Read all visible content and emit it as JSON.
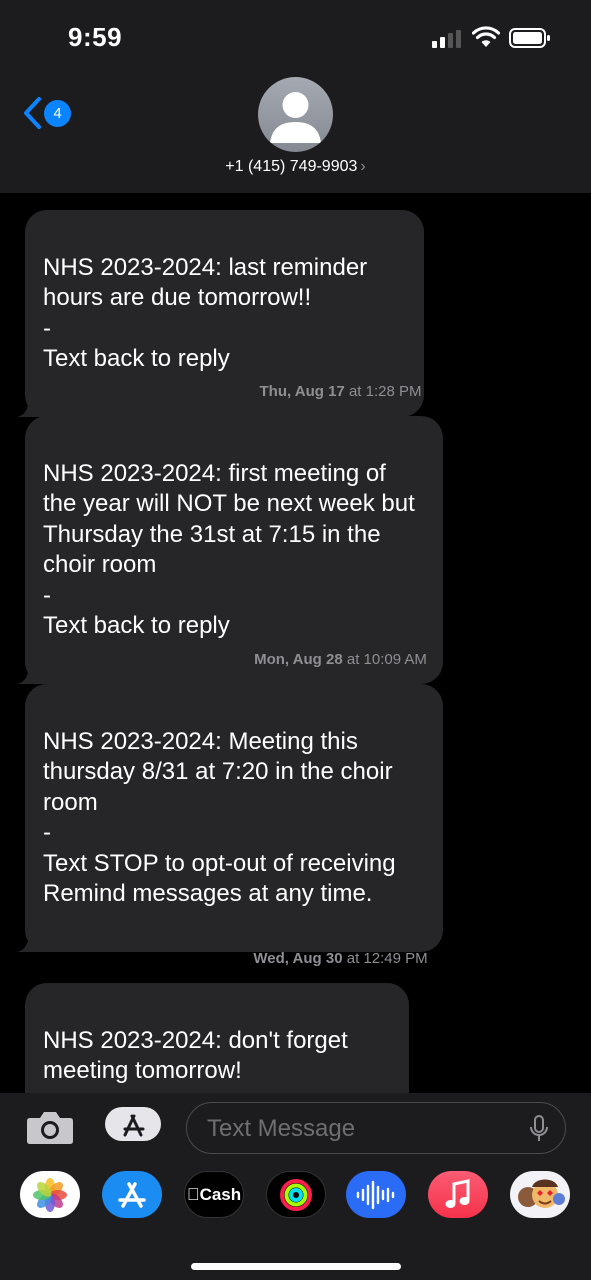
{
  "status_bar": {
    "time": "9:59"
  },
  "nav": {
    "back_count": "4",
    "contact": "+1 (415) 749-9903",
    "chevron": "›"
  },
  "messages": [
    {
      "text": "NHS 2023-2024: last reminder hours are due tomorrow!!\n-\nText back to reply"
    },
    {
      "text": "NHS 2023-2024: first meeting of the year will NOT be next week but Thursday the 31st at 7:15 in the choir room\n-\nText back to reply"
    },
    {
      "text": "NHS 2023-2024: Meeting this thursday 8/31 at 7:20 in the choir room\n-\nText STOP to opt-out of receiving Remind messages at any time."
    },
    {
      "text": "NHS 2023-2024: don't forget meeting tomorrow!\n-"
    }
  ],
  "timestamps": [
    {
      "day": "Thu, Aug 17",
      "time": " at 1:28 PM"
    },
    {
      "day": "Mon, Aug 28",
      "time": " at 10:09 AM"
    },
    {
      "day": "Wed, Aug 30",
      "time": " at 12:49 PM"
    }
  ],
  "composer": {
    "placeholder": "Text Message"
  },
  "app_strip": {
    "items": [
      "photos-icon",
      "app-store-icon",
      "apple-cash-icon",
      "fitness-icon",
      "audio-message-icon",
      "music-icon",
      "memoji-icon"
    ],
    "cash_label": "Cash"
  },
  "colors": {
    "accent": "#0a84ff",
    "bubble": "#262629",
    "header": "#1c1c1e"
  }
}
